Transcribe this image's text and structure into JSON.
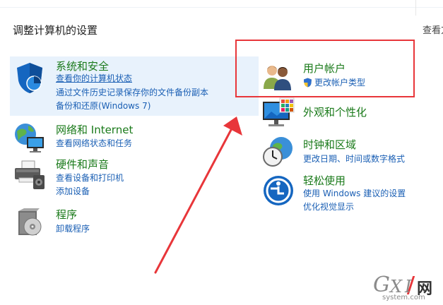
{
  "header": {
    "title": "调整计算机的设置",
    "view_by": "查看方"
  },
  "left_categories": [
    {
      "title": "系统和安全",
      "links": [
        "查看你的计算机状态",
        "通过文件历史记录保存你的文件备份副本",
        "备份和还原(Windows 7)"
      ]
    },
    {
      "title": "网络和 Internet",
      "links": [
        "查看网络状态和任务"
      ]
    },
    {
      "title": "硬件和声音",
      "links": [
        "查看设备和打印机",
        "添加设备"
      ]
    },
    {
      "title": "程序",
      "links": [
        "卸载程序"
      ]
    }
  ],
  "right_categories": [
    {
      "title": "用户帐户",
      "links": [
        "更改帐户类型"
      ]
    },
    {
      "title": "外观和个性化",
      "links": []
    },
    {
      "title": "时钟和区域",
      "links": [
        "更改日期、时间或数字格式"
      ]
    },
    {
      "title": "轻松使用",
      "links": [
        "使用 Windows 建议的设置",
        "优化视觉显示"
      ]
    }
  ],
  "watermark": {
    "g": "G",
    "x": "X",
    "i": "I",
    "net": "网",
    "site": "system.com"
  },
  "colors": {
    "category_title": "#1a7a1a",
    "link": "#1a5fb4",
    "highlight": "#e8f2fc",
    "annotation_red": "#e8363a"
  },
  "icons": {
    "system_security": "shield-icon",
    "network": "globe-monitor-icon",
    "hardware": "printer-icon",
    "programs": "programs-disc-icon",
    "user_accounts": "users-icon",
    "uac": "uac-shield-icon",
    "appearance": "monitor-palette-icon",
    "clock": "clock-globe-icon",
    "ease_of_access": "ease-of-access-icon"
  }
}
